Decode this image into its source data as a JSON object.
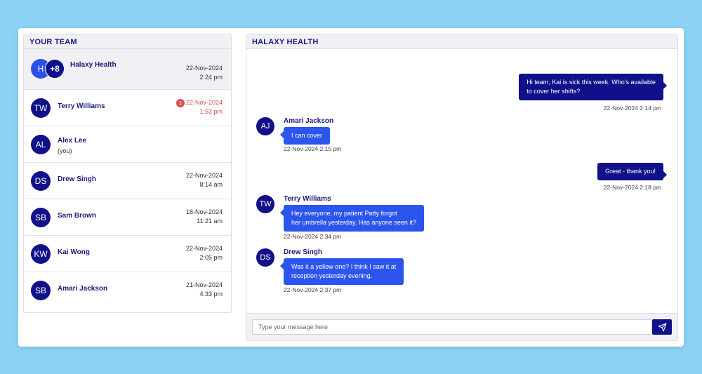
{
  "team": {
    "title": "YOUR TEAM",
    "group": {
      "initial": "H",
      "extra": "+8",
      "name": "Halaxy Health",
      "date": "22-Nov-2024",
      "time": "2:24 pm"
    },
    "members": [
      {
        "initials": "TW",
        "name": "Terry Williams",
        "sub": "",
        "date": "22-Nov-2024",
        "time": "1:53 pm",
        "unread": "1"
      },
      {
        "initials": "AL",
        "name": "Alex Lee",
        "sub": "(you)",
        "date": "",
        "time": "",
        "unread": ""
      },
      {
        "initials": "DS",
        "name": "Drew Singh",
        "sub": "",
        "date": "22-Nov-2024",
        "time": "8:14 am",
        "unread": ""
      },
      {
        "initials": "SB",
        "name": "Sam Brown",
        "sub": "",
        "date": "18-Nov-2024",
        "time": "11:21 am",
        "unread": ""
      },
      {
        "initials": "KW",
        "name": "Kai Wong",
        "sub": "",
        "date": "22-Nov-2024",
        "time": "2:05 pm",
        "unread": ""
      },
      {
        "initials": "SB",
        "name": "Amari Jackson",
        "sub": "",
        "date": "21-Nov-2024",
        "time": "4:33 pm",
        "unread": ""
      }
    ]
  },
  "chat": {
    "title": "HALAXY HEALTH",
    "messages": [
      {
        "direction": "out",
        "line1": "Hi team, Kai is sick this week. Who's available",
        "line2": "to cover her shifts?",
        "timestamp": "22-Nov-2024 2:14 pm"
      },
      {
        "direction": "in",
        "initials": "AJ",
        "sender": "Amari Jackson",
        "line1": "I can cover",
        "line2": "",
        "timestamp": "22-Nov-2024 2:15 pm"
      },
      {
        "direction": "out",
        "line1": "Great - thank you!",
        "line2": "",
        "timestamp": "22-Nov-2024 2:18 pm"
      },
      {
        "direction": "in",
        "initials": "TW",
        "sender": "Terry Williams",
        "line1": "Hey everyone, my patient Patty forgot",
        "line2": "her umbrella yesterday. Has anyone seen it?",
        "timestamp": "22-Nov-2024 2:34 pm"
      },
      {
        "direction": "in",
        "initials": "DS",
        "sender": "Drew Singh",
        "line1": "Was it a yellow one? I think  I saw it at",
        "line2": "reception yesterday evening.",
        "timestamp": "22-Nov-2024 2:37 pm"
      }
    ],
    "input_placeholder": "Type your message here",
    "send_icon": "send-icon"
  },
  "colors": {
    "background": "#8dd3f5",
    "navy": "#10108a",
    "blue": "#2c55ee",
    "unread": "#d9534f"
  }
}
